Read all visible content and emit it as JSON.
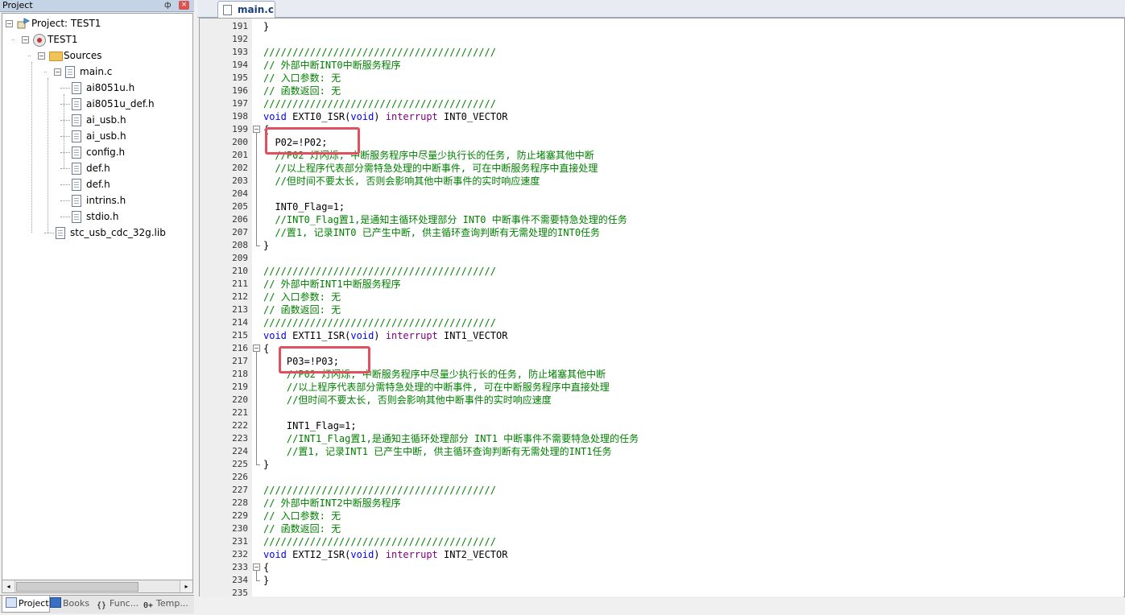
{
  "project_panel": {
    "title": "Project",
    "pin_glyph": "ф",
    "close_glyph": "×",
    "tree": [
      {
        "label": "Project: TEST1",
        "level": 0,
        "icon": "project-icon",
        "expander": "−"
      },
      {
        "label": "TEST1",
        "level": 1,
        "icon": "target-icon",
        "expander": "−"
      },
      {
        "label": "Sources",
        "level": 2,
        "icon": "folder-icon",
        "expander": "−"
      },
      {
        "label": "main.c",
        "level": 3,
        "icon": "file-icon",
        "expander": "−"
      },
      {
        "label": "ai8051u.h",
        "level": 4,
        "icon": "file-icon"
      },
      {
        "label": "ai8051u_def.h",
        "level": 4,
        "icon": "file-icon"
      },
      {
        "label": "ai_usb.h",
        "level": 4,
        "icon": "file-icon"
      },
      {
        "label": "ai_usb.h",
        "level": 4,
        "icon": "file-icon"
      },
      {
        "label": "config.h",
        "level": 4,
        "icon": "file-icon"
      },
      {
        "label": "def.h",
        "level": 4,
        "icon": "file-icon"
      },
      {
        "label": "def.h",
        "level": 4,
        "icon": "file-icon"
      },
      {
        "label": "intrins.h",
        "level": 4,
        "icon": "file-icon"
      },
      {
        "label": "stdio.h",
        "level": 4,
        "icon": "file-icon"
      },
      {
        "label": "stc_usb_cdc_32g.lib",
        "level": 3,
        "icon": "file-icon"
      }
    ],
    "scroll": {
      "left_glyph": "◂",
      "right_glyph": "▸"
    },
    "bottom_tabs": [
      {
        "label": "Project",
        "icon": "project-tab-icon",
        "active": true
      },
      {
        "label": "Books",
        "icon": "books-icon",
        "active": false
      },
      {
        "label": "Func...",
        "icon": "functions-icon",
        "active": false
      },
      {
        "label": "Temp...",
        "icon": "templates-icon",
        "active": false
      }
    ]
  },
  "editor": {
    "tab_label": "main.c",
    "lines": [
      {
        "n": "191",
        "text": "}",
        "type": "code"
      },
      {
        "n": "192",
        "text": "",
        "type": "code"
      },
      {
        "n": "193",
        "text": "////////////////////////////////////////",
        "type": "comment"
      },
      {
        "n": "194",
        "text": "// 外部中断INT0中断服务程序",
        "type": "comment"
      },
      {
        "n": "195",
        "text": "// 入口参数: 无",
        "type": "comment"
      },
      {
        "n": "196",
        "text": "// 函数返回: 无",
        "type": "comment"
      },
      {
        "n": "197",
        "text": "////////////////////////////////////////",
        "type": "comment"
      },
      {
        "n": "198",
        "text": "void EXTI0_ISR(void) interrupt INT0_VECTOR",
        "type": "decl"
      },
      {
        "n": "199",
        "text": "{",
        "type": "code"
      },
      {
        "n": "200",
        "text": "  P02=!P02;",
        "type": "code"
      },
      {
        "n": "201",
        "text": "  //P02 灯闪烁, 中断服务程序中尽量少执行长的任务, 防止堵塞其他中断",
        "type": "comment"
      },
      {
        "n": "202",
        "text": "  //以上程序代表部分需特急处理的中断事件, 可在中断服务程序中直接处理",
        "type": "comment"
      },
      {
        "n": "203",
        "text": "  //但时间不要太长, 否则会影响其他中断事件的实时响应速度",
        "type": "comment"
      },
      {
        "n": "204",
        "text": "",
        "type": "code"
      },
      {
        "n": "205",
        "text": "  INT0_Flag=1;",
        "type": "code"
      },
      {
        "n": "206",
        "text": "  //INT0_Flag置1,是通知主循环处理部分 INT0 中断事件不需要特急处理的任务",
        "type": "comment"
      },
      {
        "n": "207",
        "text": "  //置1, 记录INT0 已产生中断, 供主循环查询判断有无需处理的INT0任务",
        "type": "comment"
      },
      {
        "n": "208",
        "text": "}",
        "type": "code"
      },
      {
        "n": "209",
        "text": "",
        "type": "code"
      },
      {
        "n": "210",
        "text": "////////////////////////////////////////",
        "type": "comment"
      },
      {
        "n": "211",
        "text": "// 外部中断INT1中断服务程序",
        "type": "comment"
      },
      {
        "n": "212",
        "text": "// 入口参数: 无",
        "type": "comment"
      },
      {
        "n": "213",
        "text": "// 函数返回: 无",
        "type": "comment"
      },
      {
        "n": "214",
        "text": "////////////////////////////////////////",
        "type": "comment"
      },
      {
        "n": "215",
        "text": "void EXTI1_ISR(void) interrupt INT1_VECTOR",
        "type": "decl"
      },
      {
        "n": "216",
        "text": "{",
        "type": "code"
      },
      {
        "n": "217",
        "text": "    P03=!P03;",
        "type": "code"
      },
      {
        "n": "218",
        "text": "    //P02 灯闪烁, 中断服务程序中尽量少执行长的任务, 防止堵塞其他中断",
        "type": "comment"
      },
      {
        "n": "219",
        "text": "    //以上程序代表部分需特急处理的中断事件, 可在中断服务程序中直接处理",
        "type": "comment"
      },
      {
        "n": "220",
        "text": "    //但时间不要太长, 否则会影响其他中断事件的实时响应速度",
        "type": "comment"
      },
      {
        "n": "221",
        "text": "",
        "type": "code"
      },
      {
        "n": "222",
        "text": "    INT1_Flag=1;",
        "type": "code"
      },
      {
        "n": "223",
        "text": "    //INT1_Flag置1,是通知主循环处理部分 INT1 中断事件不需要特急处理的任务",
        "type": "comment"
      },
      {
        "n": "224",
        "text": "    //置1, 记录INT1 已产生中断, 供主循环查询判断有无需处理的INT1任务",
        "type": "comment"
      },
      {
        "n": "225",
        "text": "}",
        "type": "code"
      },
      {
        "n": "226",
        "text": "",
        "type": "code"
      },
      {
        "n": "227",
        "text": "////////////////////////////////////////",
        "type": "comment"
      },
      {
        "n": "228",
        "text": "// 外部中断INT2中断服务程序",
        "type": "comment"
      },
      {
        "n": "229",
        "text": "// 入口参数: 无",
        "type": "comment"
      },
      {
        "n": "230",
        "text": "// 函数返回: 无",
        "type": "comment"
      },
      {
        "n": "231",
        "text": "////////////////////////////////////////",
        "type": "comment"
      },
      {
        "n": "232",
        "text": "void EXTI2_ISR(void) interrupt INT2_VECTOR",
        "type": "decl"
      },
      {
        "n": "233",
        "text": "{",
        "type": "code"
      },
      {
        "n": "234",
        "text": "}",
        "type": "code"
      },
      {
        "n": "235",
        "text": "",
        "type": "code"
      }
    ],
    "colors": {
      "comment": "#008000",
      "keyword": "#0000ff",
      "interrupt_kw": "#800080",
      "highlight": "#e0505e"
    }
  }
}
